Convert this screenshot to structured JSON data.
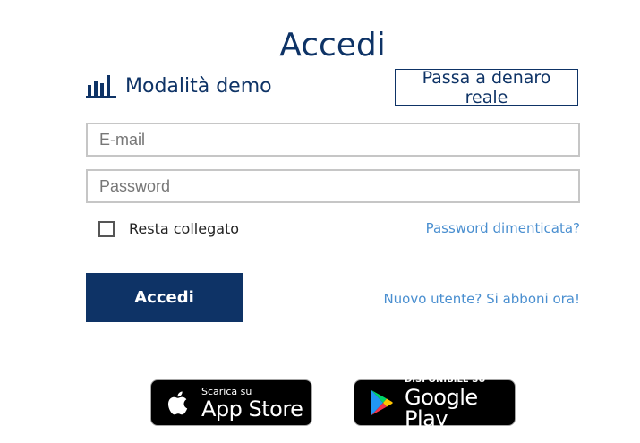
{
  "page": {
    "title": "Accedi"
  },
  "mode": {
    "label": "Modalità demo",
    "icon": "bar-chart-icon",
    "switch_label": "Passa a denaro reale"
  },
  "form": {
    "email_placeholder": "E-mail",
    "password_placeholder": "Password",
    "remember_label": "Resta collegato",
    "remember_checked": false,
    "forgot_link": "Password dimenticata?",
    "submit_label": "Accedi",
    "signup_link": "Nuovo utente? Si abboni ora!"
  },
  "stores": {
    "appstore": {
      "small": "Scarica su",
      "big": "App Store",
      "icon": "apple-icon"
    },
    "googleplay": {
      "small": "DISPONIBILE SU",
      "big": "Google Play",
      "icon": "google-play-icon"
    }
  },
  "colors": {
    "brand": "#0e3366",
    "link": "#4a8fd0",
    "border": "#c6c6c6"
  }
}
